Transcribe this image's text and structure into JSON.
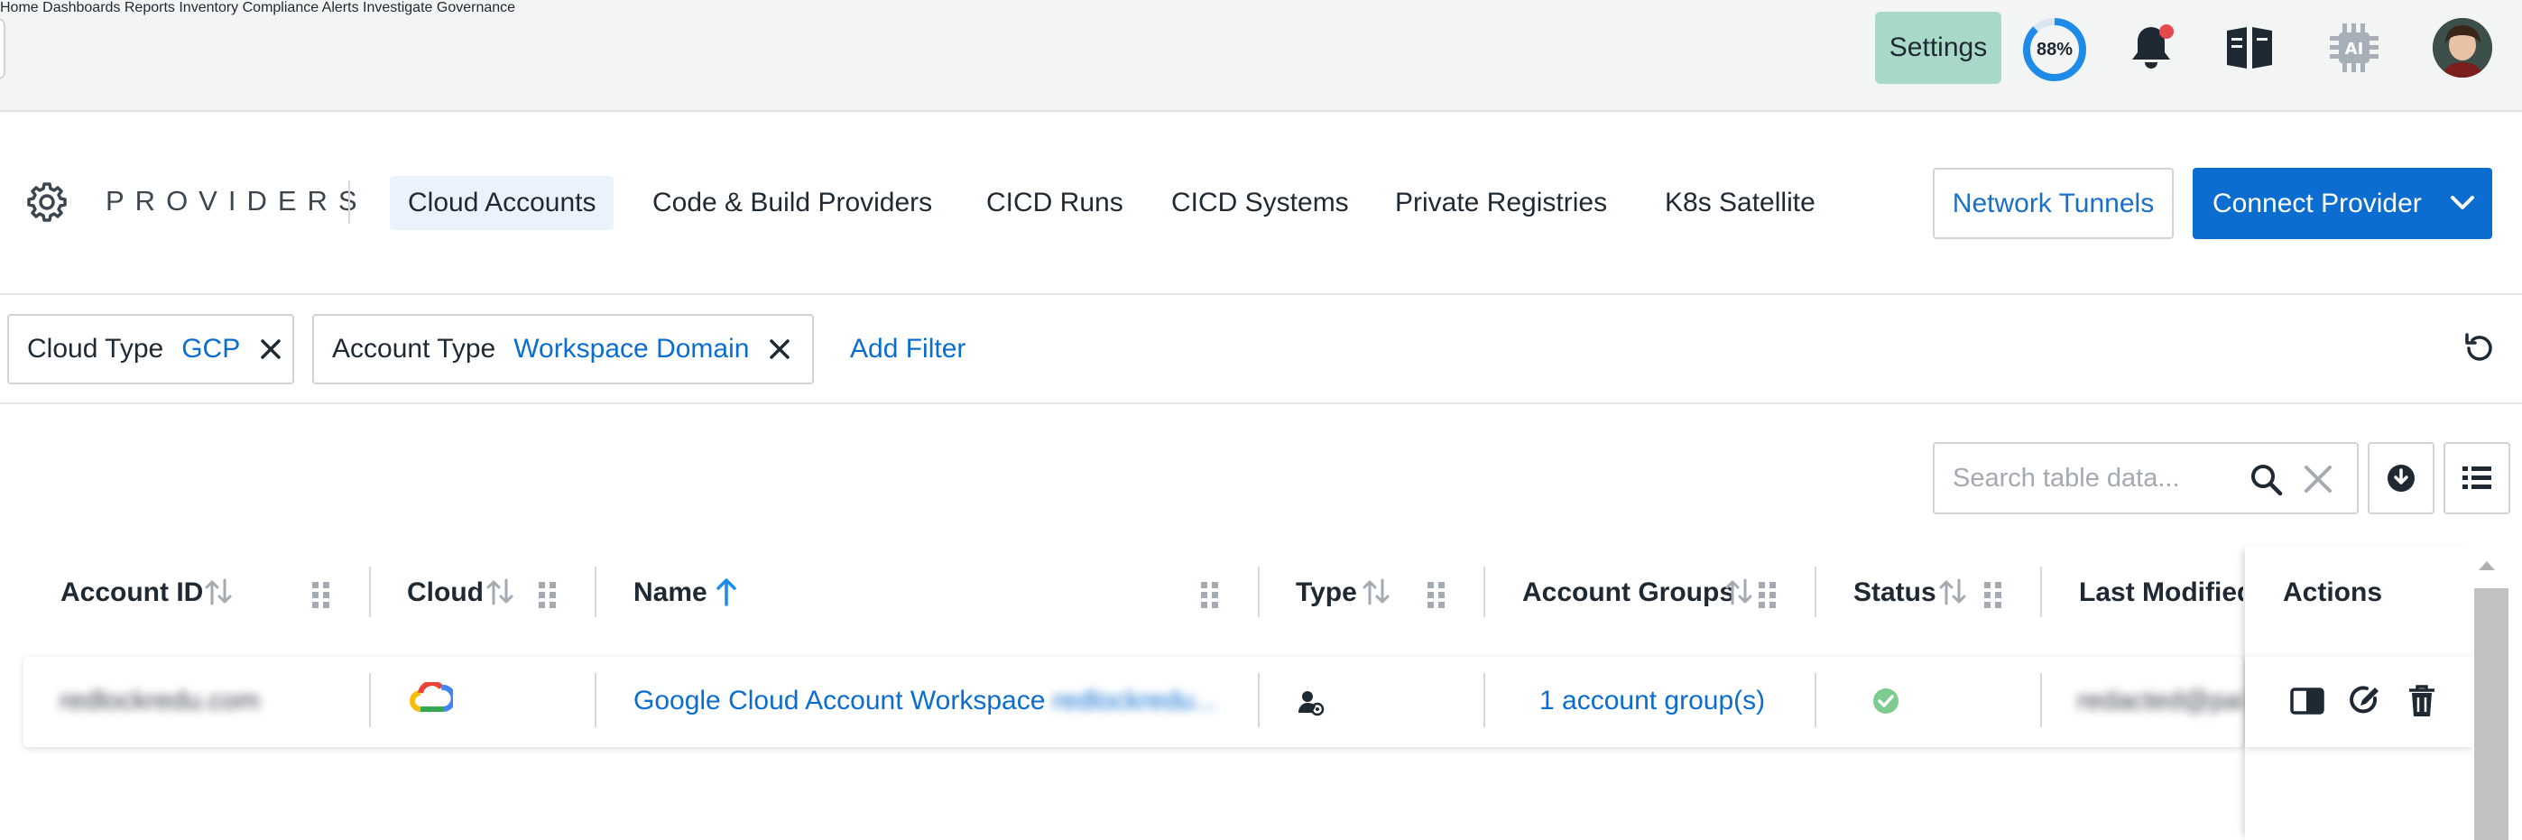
{
  "nav": {
    "items": [
      "Home",
      "Dashboards",
      "Reports",
      "Inventory",
      "Compliance",
      "Alerts",
      "Investigate",
      "Governance"
    ],
    "settings_label": "Settings",
    "progress_label": "88%",
    "progress_value": 0.88,
    "icons": [
      "bell-icon",
      "book-icon",
      "ai-chip-icon",
      "user-avatar"
    ],
    "notification_dot_color": "#e5484d"
  },
  "providers": {
    "title": "PROVIDERS",
    "tabs": [
      "Cloud Accounts",
      "Code & Build Providers",
      "CICD Runs",
      "CICD Systems",
      "Private Registries",
      "K8s Satellite"
    ],
    "active_tab": "Cloud Accounts",
    "network_tunnels_label": "Network Tunnels",
    "connect_provider_label": "Connect Provider"
  },
  "filters": {
    "chips": [
      {
        "key": "Cloud Type",
        "value": "GCP"
      },
      {
        "key": "Account Type",
        "value": "Workspace Domain"
      }
    ],
    "add_filter_label": "Add Filter"
  },
  "table": {
    "search_placeholder": "Search table data...",
    "columns": [
      "Account ID",
      "Cloud",
      "Name",
      "Type",
      "Account Groups",
      "Status",
      "Last Modified",
      "Actions"
    ],
    "rows": [
      {
        "account_id": "redlockredu.com",
        "cloud": "gcp-icon",
        "name_prefix": "Google Cloud Account Workspace",
        "name_suffix": "redlockredu...",
        "type": "workspace-user-icon",
        "account_groups": "1 account group(s)",
        "status": "enabled",
        "last_modified": "redacted@paloa"
      }
    ]
  },
  "colors": {
    "accent": "#0a6dcf",
    "settings_bg": "#a8d8c8",
    "status_ok": "#7ecb8f"
  }
}
